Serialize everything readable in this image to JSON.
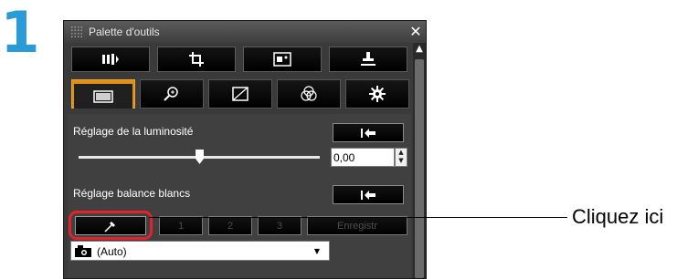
{
  "step_number": "1",
  "window": {
    "title": "Palette d'outils",
    "close_label": "✕"
  },
  "toolbar": {
    "buttons": [
      {
        "icon": "adjust-icon"
      },
      {
        "icon": "crop-icon"
      },
      {
        "icon": "image-icon"
      },
      {
        "icon": "stamp-icon"
      }
    ]
  },
  "tabs": [
    {
      "icon": "basic-adjust-icon",
      "active": true
    },
    {
      "icon": "magnify-icon",
      "active": false
    },
    {
      "icon": "tone-curve-icon",
      "active": false
    },
    {
      "icon": "color-icon",
      "active": false
    },
    {
      "icon": "settings-icon",
      "active": false
    }
  ],
  "brightness": {
    "label": "Réglage de la luminosité",
    "value": "0,00",
    "slider_level": 0.5
  },
  "white_balance": {
    "label": "Réglage balance blancs",
    "select_value": "(Auto)",
    "buttons": [
      "1",
      "2",
      "3",
      "Enregistr"
    ]
  },
  "callout": {
    "label": "Cliquez ici"
  },
  "colors": {
    "step_blue": "#2b9bd8",
    "active_tab": "#e08f14",
    "highlight": "#e8202a"
  }
}
